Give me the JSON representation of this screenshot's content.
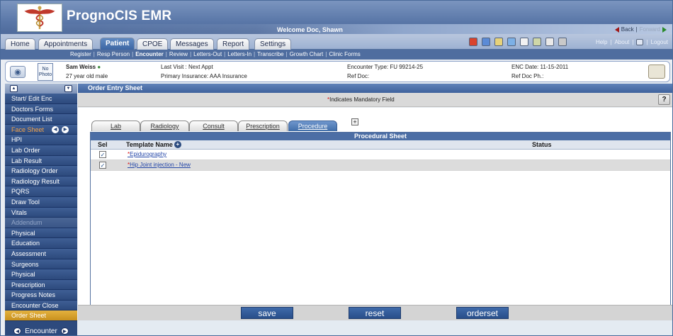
{
  "app": {
    "title": "PrognoCIS EMR",
    "welcome": "Welcome Doc, Shawn",
    "back": "Back",
    "forward": "Forward"
  },
  "nav_tabs": [
    "Home",
    "Appointments",
    "Patient",
    "CPOE",
    "Messages",
    "Report",
    "Settings"
  ],
  "active_tab": "Patient",
  "header_links": [
    "Help",
    "About",
    "Logout"
  ],
  "subnav": [
    "Register",
    "Resp Person",
    "Encounter",
    "Review",
    "Letters-Out",
    "Letters-In",
    "Transcribe",
    "Growth Chart",
    "Clinic Forms"
  ],
  "subnav_active": "Encounter",
  "patient": {
    "no_photo": "No Photo",
    "name": "Sam Weiss",
    "age": "27 year old male",
    "last_visit": "Last Visit : Next Appt",
    "insurance": "Primary Insurance: AAA Insurance",
    "encounter_type": "Encounter Type: FU 99214-25",
    "ref_doc": "Ref Doc:",
    "enc_date": "ENC Date: 11-15-2011",
    "ref_doc_ph": "Ref Doc Ph.:"
  },
  "sidebar": {
    "items": [
      {
        "label": "Start/ Edit Enc",
        "style": ""
      },
      {
        "label": "Doctors Forms",
        "style": ""
      },
      {
        "label": "Document List",
        "style": ""
      },
      {
        "label": "Face Sheet",
        "style": "orange"
      },
      {
        "label": "HPI",
        "style": ""
      },
      {
        "label": "Lab Order",
        "style": ""
      },
      {
        "label": "Lab Result",
        "style": ""
      },
      {
        "label": "Radiology Order",
        "style": ""
      },
      {
        "label": "Radiology Result",
        "style": ""
      },
      {
        "label": "PQRS",
        "style": ""
      },
      {
        "label": "Draw Tool",
        "style": ""
      },
      {
        "label": "Vitals",
        "style": ""
      },
      {
        "label": "Addendum",
        "style": "dim"
      },
      {
        "label": "Physical",
        "style": ""
      },
      {
        "label": "Education",
        "style": ""
      },
      {
        "label": "Assessment",
        "style": ""
      },
      {
        "label": "Surgeons",
        "style": ""
      },
      {
        "label": "Physical",
        "style": ""
      },
      {
        "label": "Prescription",
        "style": ""
      },
      {
        "label": "Progress Notes",
        "style": ""
      },
      {
        "label": "Encounter Close",
        "style": ""
      },
      {
        "label": "Order Sheet",
        "style": "active"
      }
    ],
    "footer": "Encounter"
  },
  "main": {
    "title": "Order Entry Sheet",
    "mandatory_star": "*",
    "mandatory_text": "Indicates Mandatory Field",
    "help_button": "?",
    "sheet_tabs": [
      "Lab",
      "Radiology",
      "Consult",
      "Prescription",
      "Procedure"
    ],
    "active_sheet_tab": "Procedure",
    "panel_title": "Procedural Sheet",
    "columns": {
      "sel": "Sel",
      "template": "Template Name",
      "status": "Status"
    },
    "rows": [
      {
        "star": "*",
        "name": "Epidurography",
        "checked": true,
        "status": ""
      },
      {
        "star": "*",
        "name": "Hip Joint injection - New",
        "checked": true,
        "status": ""
      }
    ],
    "buttons": {
      "save": "save",
      "reset": "reset",
      "orderset": "orderset"
    }
  }
}
